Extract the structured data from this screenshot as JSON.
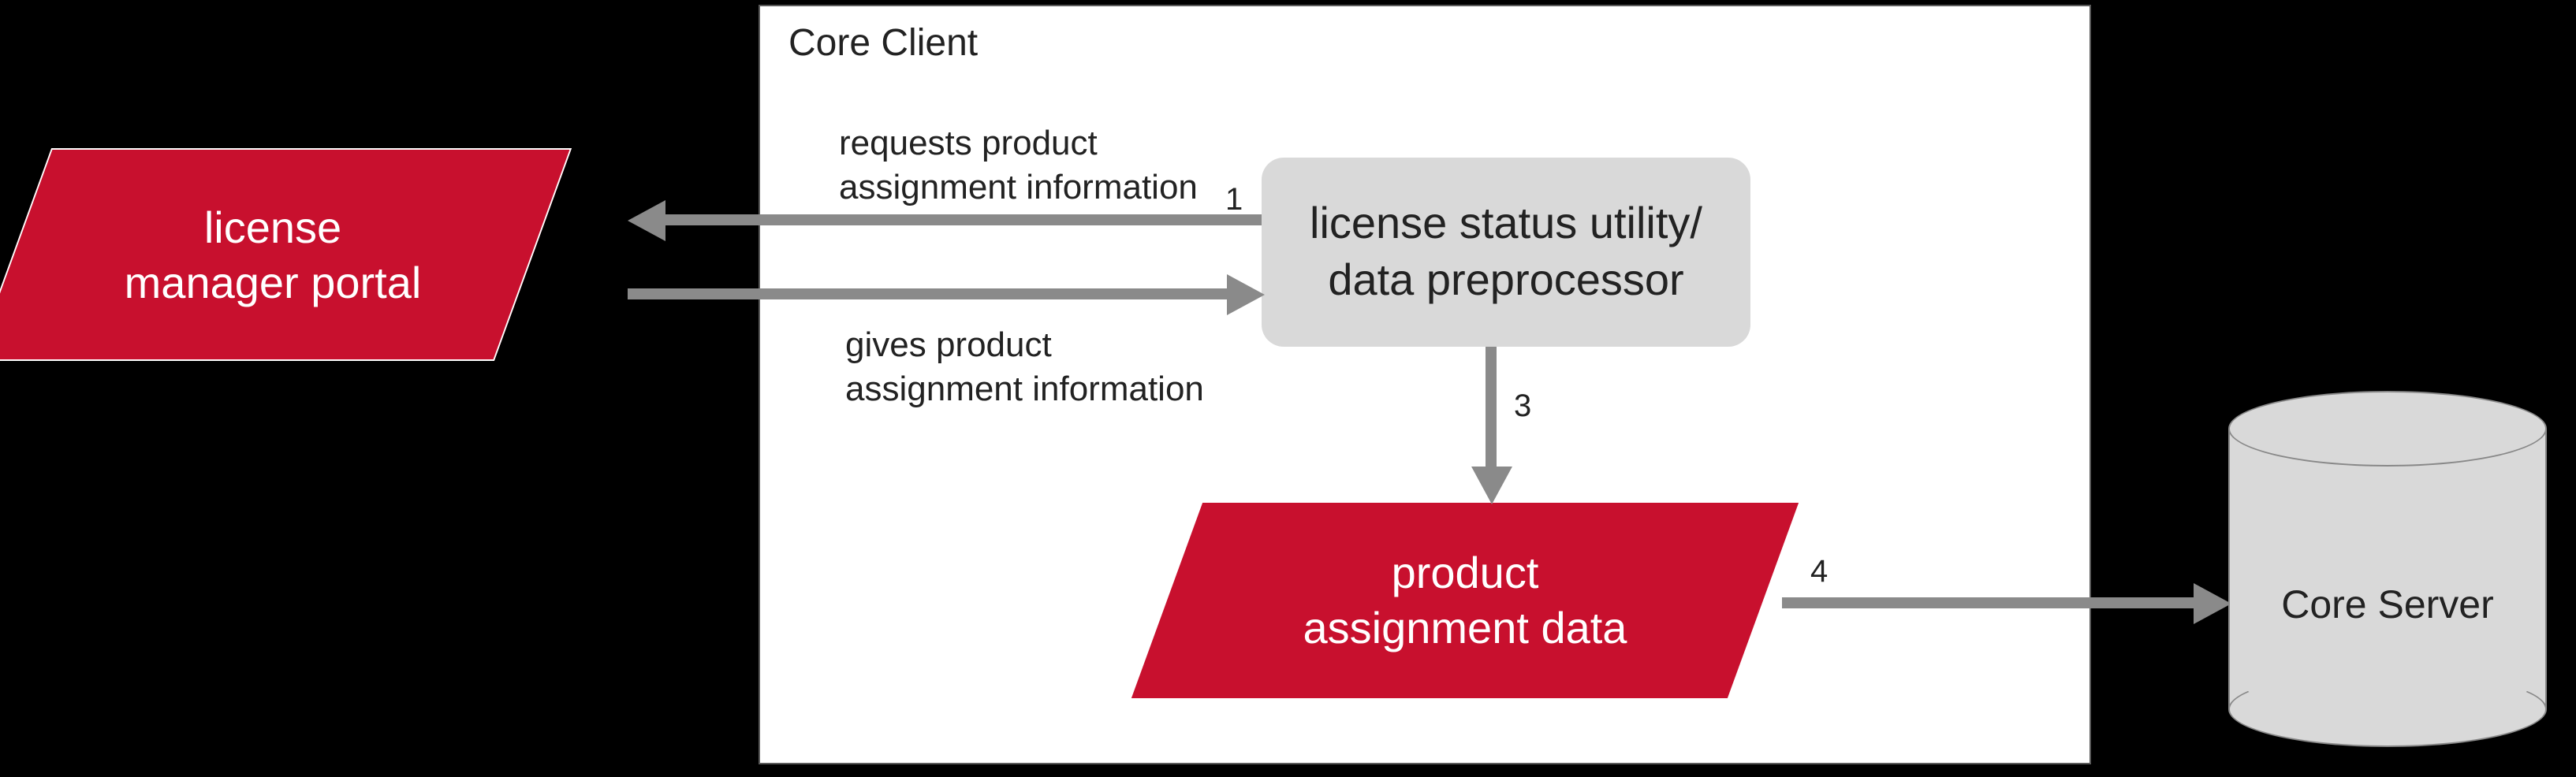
{
  "container": {
    "title": "Core Client"
  },
  "nodes": {
    "portal": "license\nmanager portal",
    "utility": "license status utility/\ndata preprocessor",
    "product_data": "product\nassignment data",
    "core_server": "Core Server"
  },
  "edges": {
    "request": "requests product\nassignment information",
    "give": "gives product\nassignment information"
  },
  "steps": {
    "s1": "1",
    "s3": "3",
    "s4": "4"
  }
}
